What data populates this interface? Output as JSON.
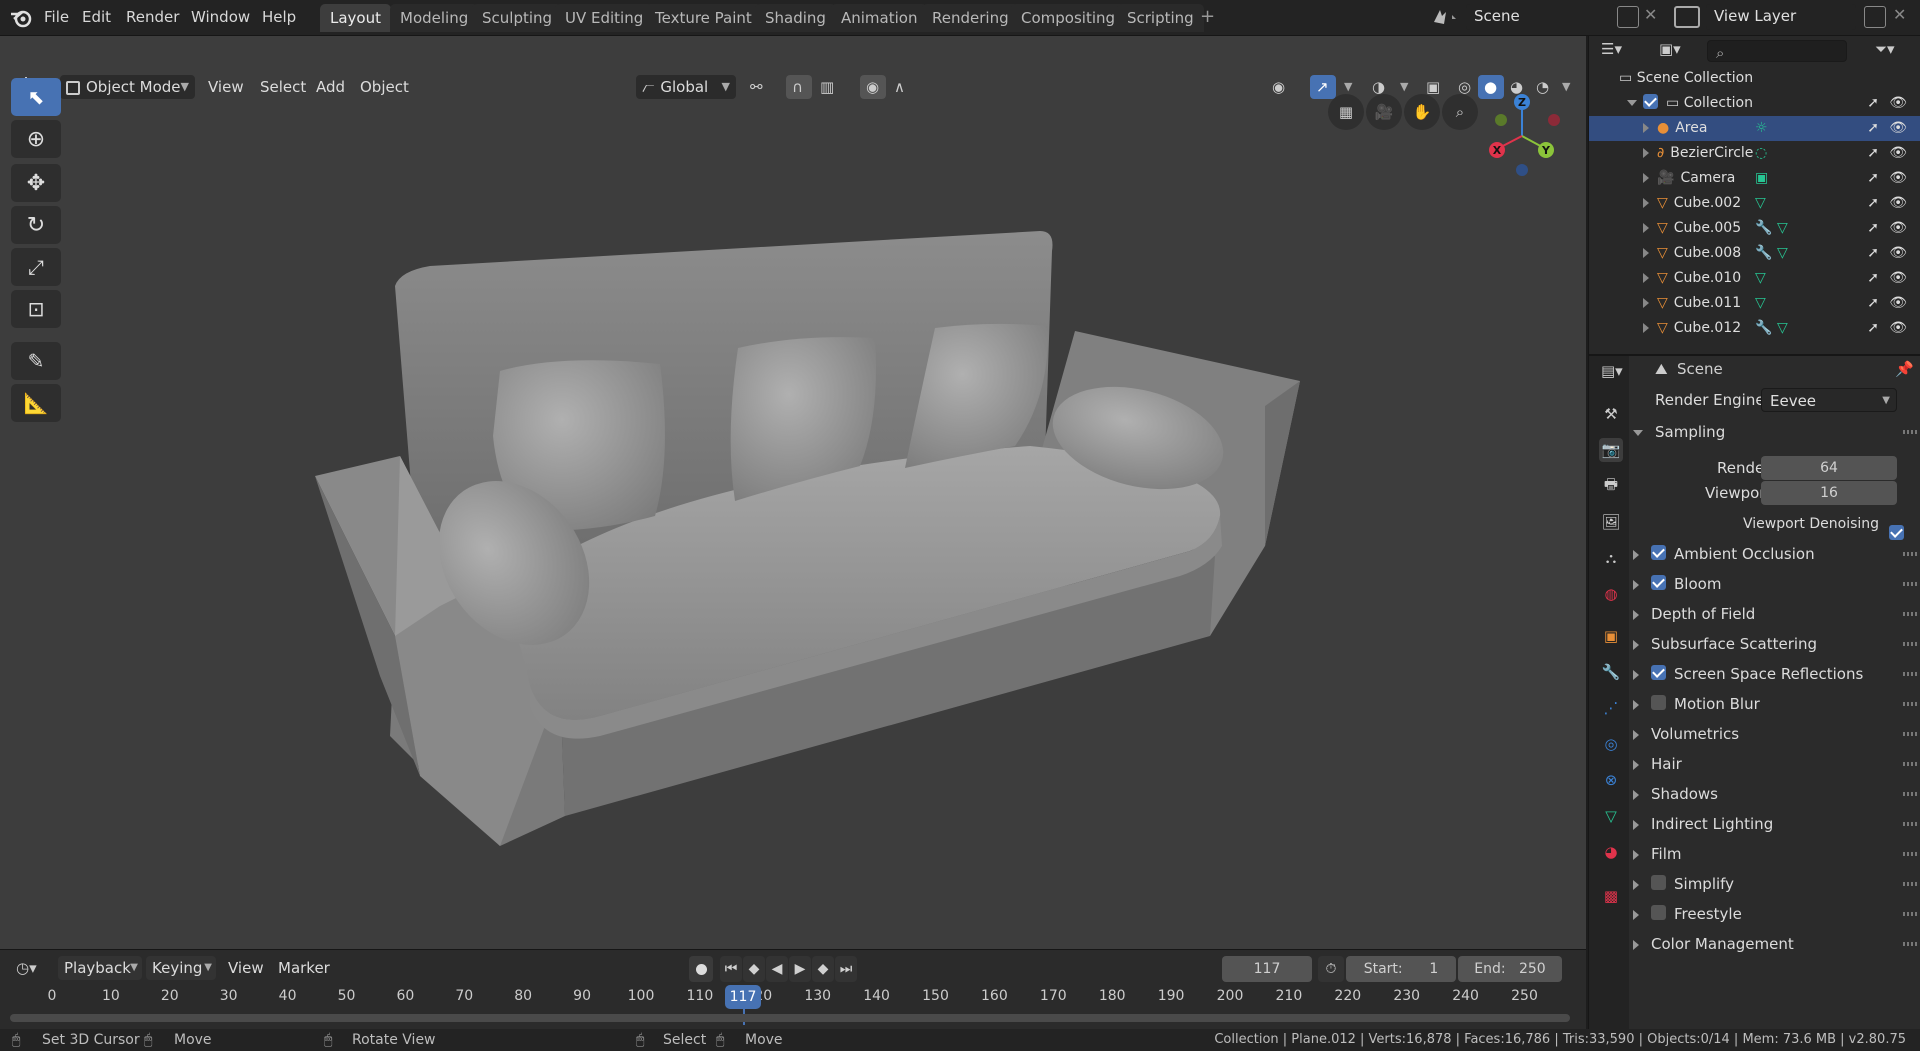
{
  "topbar": {
    "menus": [
      "File",
      "Edit",
      "Render",
      "Window",
      "Help"
    ],
    "workspaces": [
      "Layout",
      "Modeling",
      "Sculpting",
      "UV Editing",
      "Texture Paint",
      "Shading",
      "Animation",
      "Rendering",
      "Compositing",
      "Scripting"
    ],
    "active_workspace": "Layout",
    "add_workspace": "+",
    "scene": "Scene",
    "view_layer": "View Layer"
  },
  "viewport_header": {
    "mode": "Object Mode",
    "menus": [
      "View",
      "Select",
      "Add",
      "Object"
    ],
    "orientation": "Global"
  },
  "gizmo": {
    "x": "X",
    "y": "Y",
    "z": "Z"
  },
  "outliner": {
    "root": "Scene Collection",
    "collection": "Collection",
    "items": [
      {
        "name": "Area",
        "selected": true
      },
      {
        "name": "BezierCircle"
      },
      {
        "name": "Camera"
      },
      {
        "name": "Cube.002"
      },
      {
        "name": "Cube.005"
      },
      {
        "name": "Cube.008"
      },
      {
        "name": "Cube.010"
      },
      {
        "name": "Cube.011"
      },
      {
        "name": "Cube.012"
      }
    ]
  },
  "properties": {
    "context": "Scene",
    "render_engine_label": "Render Engine",
    "render_engine": "Eevee",
    "sampling": {
      "title": "Sampling",
      "render_label": "Render",
      "render": "64",
      "viewport_label": "Viewport",
      "viewport": "16",
      "denoise_label": "Viewport Denoising",
      "denoise": true
    },
    "panels": [
      {
        "label": "Ambient Occlusion",
        "checkbox": true,
        "checked": true
      },
      {
        "label": "Bloom",
        "checkbox": true,
        "checked": true
      },
      {
        "label": "Depth of Field",
        "checkbox": false
      },
      {
        "label": "Subsurface Scattering",
        "checkbox": false
      },
      {
        "label": "Screen Space Reflections",
        "checkbox": true,
        "checked": true
      },
      {
        "label": "Motion Blur",
        "checkbox": true,
        "checked": false
      },
      {
        "label": "Volumetrics",
        "checkbox": false
      },
      {
        "label": "Hair",
        "checkbox": false
      },
      {
        "label": "Shadows",
        "checkbox": false
      },
      {
        "label": "Indirect Lighting",
        "checkbox": false
      },
      {
        "label": "Film",
        "checkbox": false
      },
      {
        "label": "Simplify",
        "checkbox": true,
        "checked": false
      },
      {
        "label": "Freestyle",
        "checkbox": true,
        "checked": false
      },
      {
        "label": "Color Management",
        "checkbox": false
      }
    ]
  },
  "timeline": {
    "menus": [
      "Playback",
      "Keying",
      "View",
      "Marker"
    ],
    "current_frame": "117",
    "start_label": "Start:",
    "start": "1",
    "end_label": "End:",
    "end": "250",
    "ticks": [
      "0",
      "10",
      "20",
      "30",
      "40",
      "50",
      "60",
      "70",
      "80",
      "90",
      "100",
      "110",
      "120",
      "130",
      "140",
      "150",
      "160",
      "170",
      "180",
      "190",
      "200",
      "210",
      "220",
      "230",
      "240",
      "250"
    ]
  },
  "statusbar": {
    "hints": [
      "Set 3D Cursor",
      "Move",
      "Rotate View",
      "Select",
      "Move"
    ],
    "info": "Collection | Plane.012 | Verts:16,878 | Faces:16,786 | Tris:33,590 | Objects:0/14 | Mem: 73.6 MB | v2.80.75"
  },
  "colors": {
    "accent": "#4772b3",
    "selection": "#334d80",
    "x_axis": "#e0334b",
    "y_axis": "#8bc43a",
    "z_axis": "#3b82d6",
    "object_orange": "#e88f37",
    "mesh_green": "#27c593"
  }
}
